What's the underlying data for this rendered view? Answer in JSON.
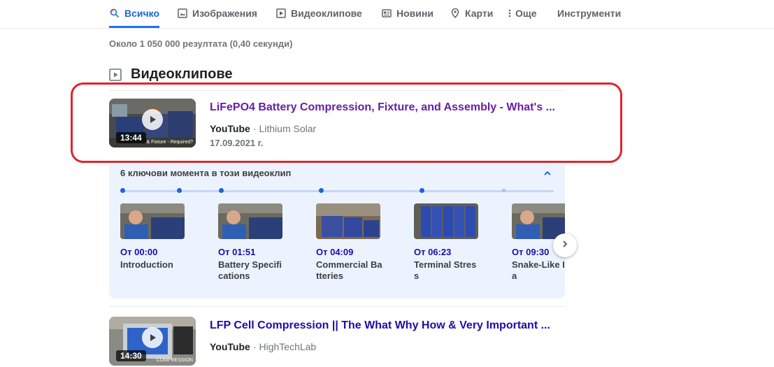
{
  "nav": {
    "tabs": [
      {
        "label": "Всичко",
        "icon": "search-icon",
        "active": true
      },
      {
        "label": "Изображения",
        "icon": "image-icon"
      },
      {
        "label": "Видеоклипове",
        "icon": "video-icon"
      },
      {
        "label": "Новини",
        "icon": "news-icon"
      },
      {
        "label": "Карти",
        "icon": "map-pin-icon"
      },
      {
        "label": "Още",
        "icon": "more-vert-icon"
      },
      {
        "label": "Инструменти"
      }
    ]
  },
  "stats": "Около 1 050 000 резултата (0,40 секунди)",
  "videos_section": {
    "title": "Видеоклипове",
    "results": [
      {
        "title": "LiFePO4 Battery Compression, Fixture, and Assembly - What's ...",
        "site": "YouTube",
        "channel": "Lithium Solar",
        "date": "17.09.2021 г.",
        "duration": "13:44",
        "thumb_caption": "& Fixture - Required?"
      },
      {
        "title": "LFP Cell Compression || The What Why How & Very Important ...",
        "site": "YouTube",
        "channel": "HighTechLab",
        "date": "",
        "duration": "14:30",
        "thumb_caption": "COMPRESSION"
      }
    ]
  },
  "key_moments": {
    "title": "6 ключови момента в този видеоклип",
    "moments": [
      {
        "time": "От 00:00",
        "label": "Introduction"
      },
      {
        "time": "От 01:51",
        "label": "Battery Specifications"
      },
      {
        "time": "От 04:09",
        "label": "Commercial Batteries"
      },
      {
        "time": "От 06:23",
        "label": "Terminal Stress"
      },
      {
        "time": "От 09:30",
        "label": "Snake-Like Idea"
      }
    ]
  },
  "colors": {
    "accent": "#1a73e8",
    "link_visited": "#681da8",
    "link": "#1a0dab",
    "annotation": "#e0242e",
    "key_moments_bg": "#edf3fe"
  }
}
